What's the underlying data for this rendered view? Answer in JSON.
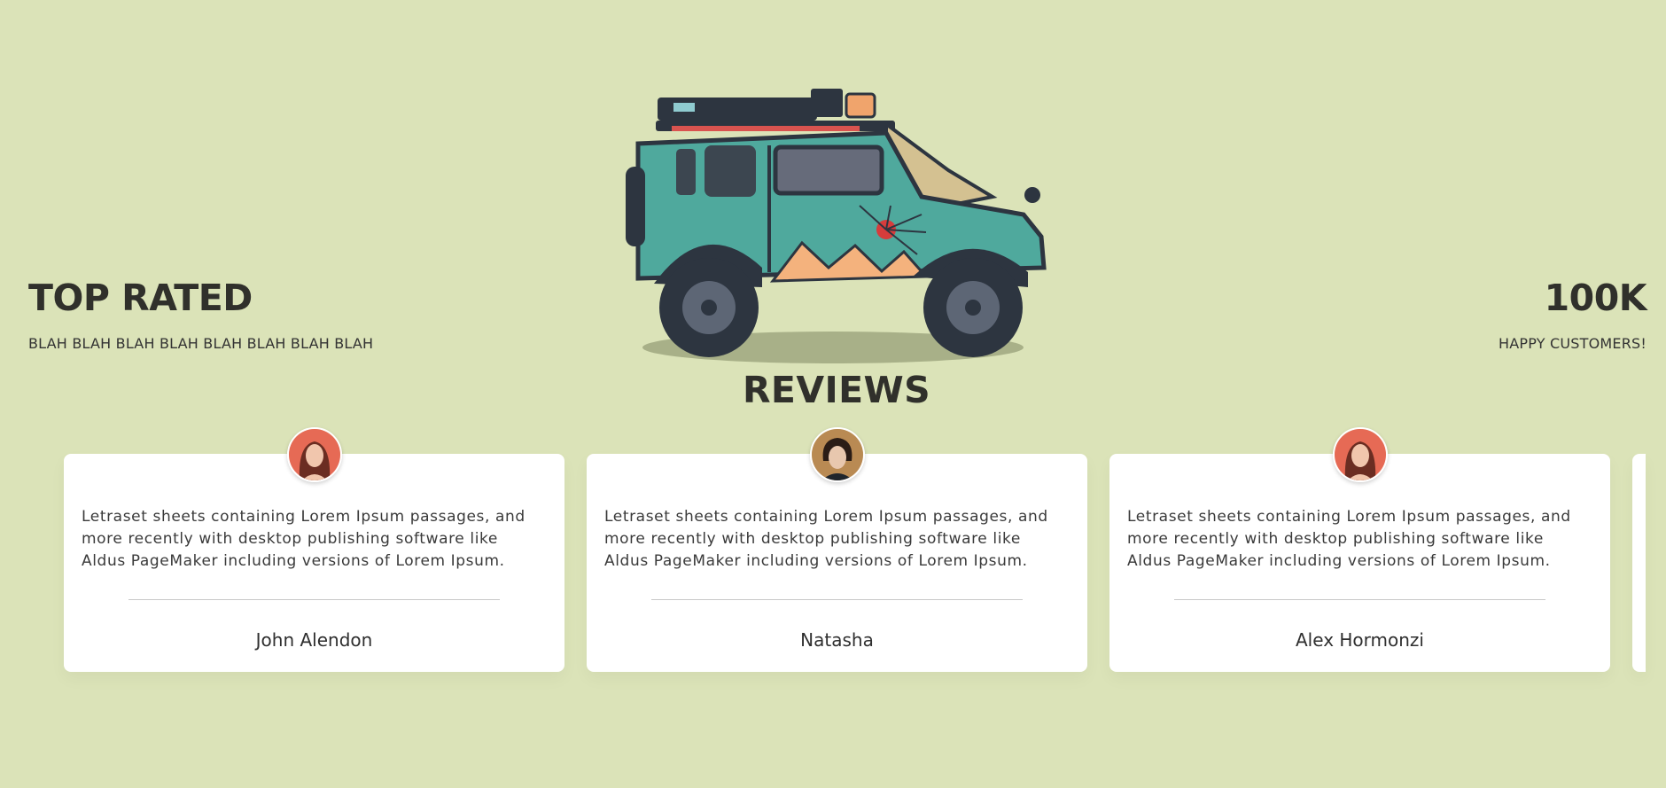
{
  "stats": {
    "left": {
      "title": "TOP RATED",
      "subtitle": "BLAH BLAH BLAH BLAH BLAH BLAH BLAH BLAH"
    },
    "right": {
      "title": "100K",
      "subtitle": "HAPPY CUSTOMERS!"
    }
  },
  "hero": {
    "image": "offroad-jeep-illustration"
  },
  "reviews": {
    "title": "REVIEWS",
    "items": [
      {
        "text": "Letraset sheets containing Lorem Ipsum passages, and more recently with desktop publishing software like Aldus PageMaker including versions of Lorem Ipsum.",
        "name": "John Alendon",
        "avatar": "woman-red-hair-avatar"
      },
      {
        "text": "Letraset sheets containing Lorem Ipsum passages, and more recently with desktop publishing software like Aldus PageMaker including versions of Lorem Ipsum.",
        "name": "Natasha",
        "avatar": "young-man-dark-hair-avatar"
      },
      {
        "text": "Letraset sheets containing Lorem Ipsum passages, and more recently with desktop publishing software like Aldus PageMaker including versions of Lorem Ipsum.",
        "name": "Alex Hormonzi",
        "avatar": "woman-red-hair-avatar"
      }
    ]
  },
  "colors": {
    "background": "#dbe3b8",
    "heading": "#30302b",
    "card": "#ffffff",
    "jeep_body": "#4fa99d"
  }
}
